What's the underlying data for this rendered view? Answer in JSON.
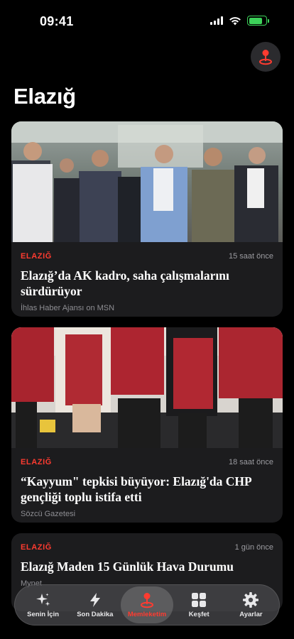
{
  "status_bar": {
    "time": "09:41",
    "battery_level": 0.8,
    "signal_bars": 4
  },
  "header": {
    "title": "Elazığ",
    "location_button_icon": "location-pin-icon"
  },
  "accent_color": "#ff3b30",
  "articles": [
    {
      "category": "ELAZIĞ",
      "time": "15 saat önce",
      "title": "Elazığ’da AK kadro, saha çalışmalarını sürdürüyor",
      "source": "İhlas Haber Ajansı on MSN",
      "has_image": true
    },
    {
      "category": "ELAZIĞ",
      "time": "18 saat önce",
      "title": "“Kayyum\" tepkisi büyüyor: Elazığ'da CHP gençliği toplu istifa etti",
      "source": "Sözcü Gazetesi",
      "has_image": true
    },
    {
      "category": "ELAZIĞ",
      "time": "1 gün önce",
      "title": "Elazığ Maden 15 Günlük Hava Durumu",
      "source": "Mynet",
      "has_image": false
    }
  ],
  "tab_bar": {
    "tabs": [
      {
        "label": "Senin İçin",
        "icon": "sparkle-icon",
        "active": false
      },
      {
        "label": "Son Dakika",
        "icon": "lightning-icon",
        "active": false
      },
      {
        "label": "Memleketim",
        "icon": "location-pin-icon",
        "active": true
      },
      {
        "label": "Keşfet",
        "icon": "grid-icon",
        "active": false
      },
      {
        "label": "Ayarlar",
        "icon": "gear-icon",
        "active": false
      }
    ]
  }
}
